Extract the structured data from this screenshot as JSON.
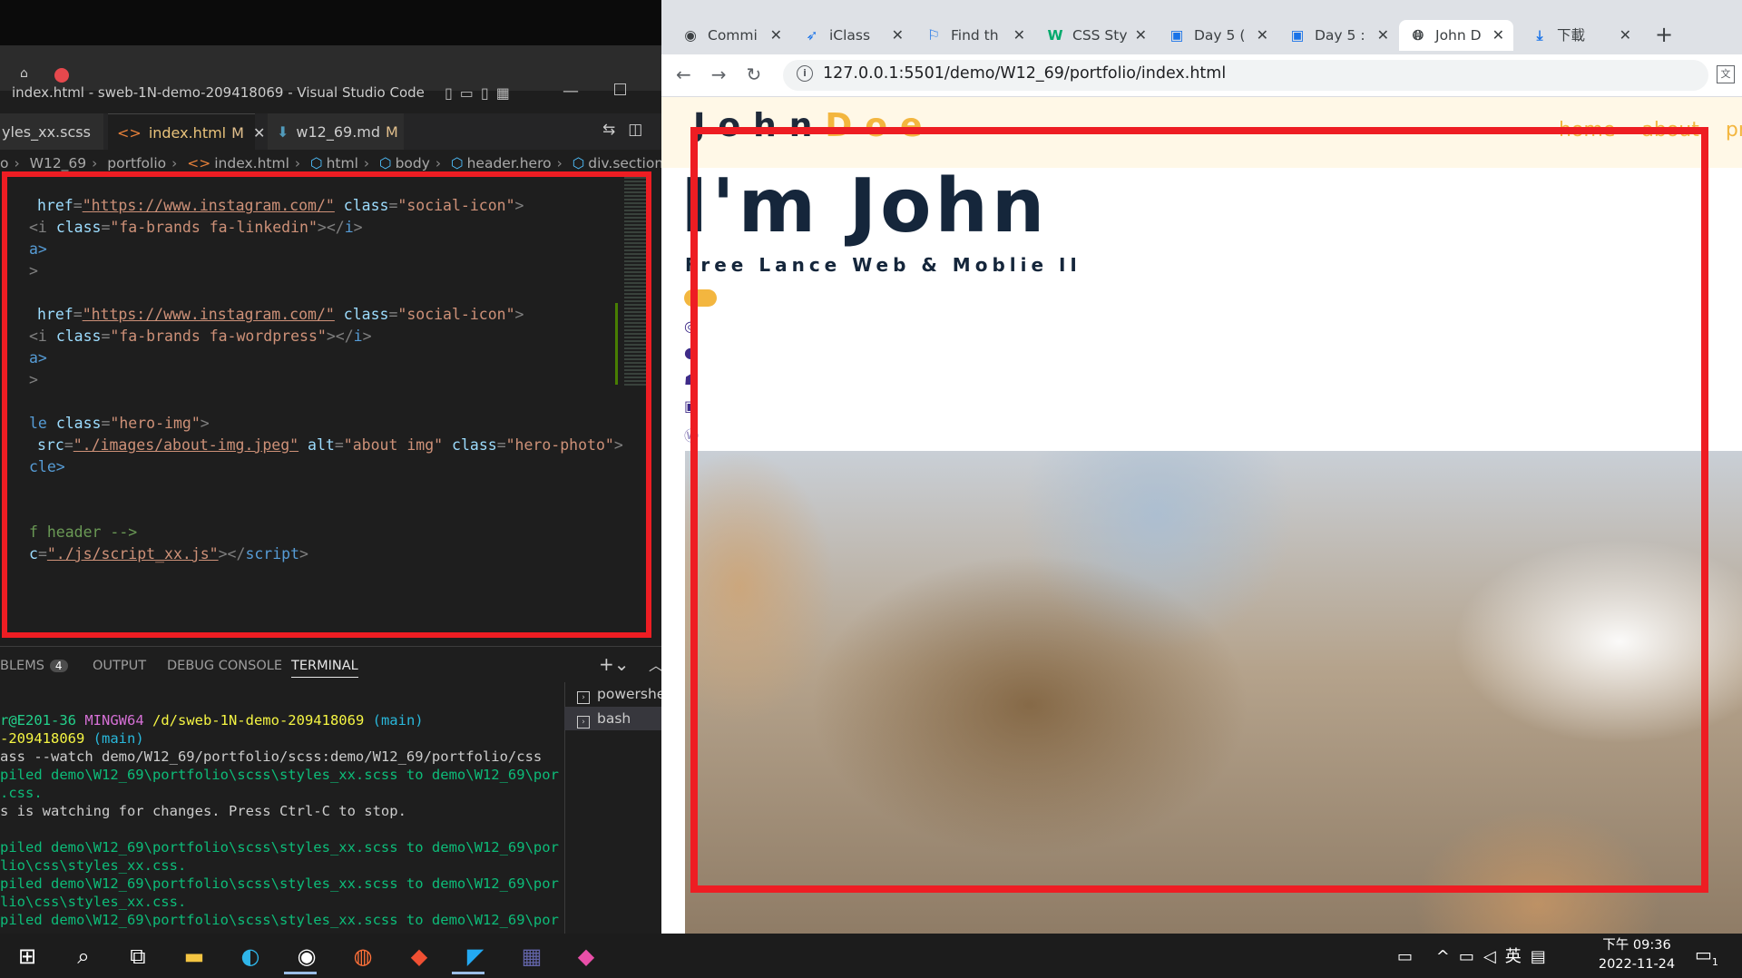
{
  "vscode": {
    "window_title": "index.html - sweb-1N-demo-209418069 - Visual Studio Code",
    "tabs": [
      {
        "label": "yles_xx.scss"
      },
      {
        "label": "index.html",
        "status": "M"
      },
      {
        "label": "w12_69.md",
        "status": "M"
      }
    ],
    "breadcrumb": [
      "o",
      "W12_69",
      "portfolio",
      "index.html",
      "html",
      "body",
      "header.hero",
      "div.section-cen"
    ],
    "code": {
      "l1": {
        "a": "href",
        "b": "\"https://www.instagram.com/\"",
        "c": "class",
        "d": "\"social-icon\""
      },
      "l2": {
        "a": "<i ",
        "b": "class",
        "c": "\"fa-brands fa-linkedin\"",
        "d": "></",
        "e": "i",
        "f": ">"
      },
      "l3": "a>",
      "l4": ">",
      "l5": {
        "a": "href",
        "b": "\"https://www.instagram.com/\"",
        "c": "class",
        "d": "\"social-icon\""
      },
      "l6": {
        "a": "<i ",
        "b": "class",
        "c": "\"fa-brands fa-wordpress\"",
        "d": "></",
        "e": "i",
        "f": ">"
      },
      "l7": "a>",
      "l8": ">",
      "l9": {
        "a": "le ",
        "b": "class",
        "c": "\"hero-img\"",
        "d": ">"
      },
      "l10": {
        "a": "src",
        "b": "\"./images/about-img.jpeg\"",
        "c": "alt",
        "d": "\"about img\"",
        "e": "class",
        "f": "\"hero-photo\"",
        "g": ">"
      },
      "l11": "cle>",
      "l12": "f header -->",
      "l13": {
        "a": "c",
        "b": "\"./js/script_xx.js\"",
        "c": "></",
        "d": "script",
        "e": ">"
      }
    },
    "panel": {
      "tabs": [
        "BLEMS",
        "OUTPUT",
        "DEBUG CONSOLE",
        "TERMINAL"
      ],
      "problems_count": "4",
      "terminals": [
        "powershe",
        "bash"
      ],
      "lines": {
        "t1a": "r@E201-36 ",
        "t1b": "MINGW64 ",
        "t1c": "/d/sweb-1N-demo-209418069 ",
        "t1d": "(main)",
        "t2a": "-209418069 ",
        "t2b": "(main)",
        "t3": "ass --watch demo/W12_69/portfolio/scss:demo/W12_69/portfolio/css",
        "t4": "piled demo\\W12_69\\portfolio\\scss\\styles_xx.scss to demo\\W12_69\\por",
        "t5": ".css.",
        "t6": "s is watching for changes. Press Ctrl-C to stop.",
        "t7": "piled demo\\W12_69\\portfolio\\scss\\styles_xx.scss to demo\\W12_69\\por",
        "t8": "lio\\css\\styles_xx.css.",
        "t9": "piled demo\\W12_69\\portfolio\\scss\\styles_xx.scss to demo\\W12_69\\por",
        "t10": "lio\\css\\styles_xx.css.",
        "t11": "piled demo\\W12_69\\portfolio\\scss\\styles_xx.scss to demo\\W12_69\\por"
      }
    }
  },
  "chrome": {
    "tabs": [
      {
        "label": "Commi",
        "icon": "github-icon"
      },
      {
        "label": "iClass",
        "icon": "feather-icon"
      },
      {
        "label": "Find th",
        "icon": "flag-icon"
      },
      {
        "label": "CSS Sty",
        "icon": "w3schools-icon"
      },
      {
        "label": "Day 5 (",
        "icon": "ithelp-icon"
      },
      {
        "label": "Day 5 :",
        "icon": "ithelp-icon"
      },
      {
        "label": "John D",
        "icon": "globe-icon"
      },
      {
        "label": "下載",
        "icon": "download-icon"
      }
    ],
    "url": "127.0.0.1:5501/demo/W12_69/portfolio/index.html"
  },
  "page": {
    "logo_first": "John",
    "logo_last": "Doe",
    "nav": [
      "home",
      "about",
      "proj"
    ],
    "hero_title": "I'm John",
    "hero_subtitle": "Free Lance Web & Moblie II",
    "colors": {
      "accent": "#f3b63f",
      "navy": "#15263b",
      "header_bg": "#fff8e7",
      "annotation": "#ee1d23"
    }
  },
  "taskbar": {
    "apps": [
      "start-icon",
      "search-icon",
      "task-view-icon",
      "file-explorer-icon",
      "edge-icon",
      "chrome-icon",
      "firefox-icon",
      "git-icon",
      "vscode-icon",
      "teams-icon",
      "app-icon"
    ],
    "ime": "英",
    "time": "下午 09:36",
    "date": "2022-11-24",
    "notifications": "1"
  }
}
